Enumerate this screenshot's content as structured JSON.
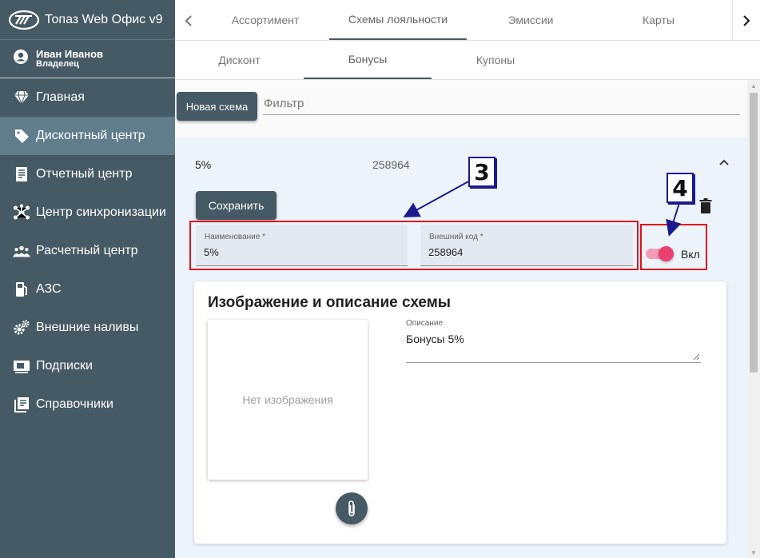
{
  "app": {
    "title": "Топаз Web Офис v9"
  },
  "user": {
    "name": "Иван Иванов",
    "role": "Владелец"
  },
  "sidebar": {
    "items": [
      {
        "label": "Главная",
        "icon": "diamond-icon"
      },
      {
        "label": "Дисконтный центр",
        "icon": "tag-icon",
        "active": true
      },
      {
        "label": "Отчетный центр",
        "icon": "report-icon"
      },
      {
        "label": "Центр синхронизации",
        "icon": "sync-hub-icon"
      },
      {
        "label": "Расчетный центр",
        "icon": "people-group-icon"
      },
      {
        "label": "АЗС",
        "icon": "fuel-pump-icon"
      },
      {
        "label": "Внешние наливы",
        "icon": "gears-icon"
      },
      {
        "label": "Подписки",
        "icon": "subscription-icon"
      },
      {
        "label": "Справочники",
        "icon": "library-icon"
      }
    ]
  },
  "tabs_main": [
    "Ассортимент",
    "Схемы лояльности",
    "Эмиссии",
    "Карты"
  ],
  "tabs_main_active": "Схемы лояльности",
  "tabs_sub": [
    "Дисконт",
    "Бонусы",
    "Купоны"
  ],
  "tabs_sub_active": "Бонусы",
  "toolbar": {
    "new_scheme_label": "Новая схема",
    "filter_placeholder": "Фильтр"
  },
  "scheme": {
    "header_name": "5%",
    "header_code": "258964",
    "save_label": "Сохранить",
    "name_label": "Наименование *",
    "name_value": "5%",
    "code_label": "Внешний код *",
    "code_value": "258964",
    "toggle_label": "Вкл",
    "toggle_on": true
  },
  "image_section": {
    "title": "Изображение и описание схемы",
    "no_image": "Нет изображения",
    "description_label": "Описание",
    "description_value": "Бонусы 5%"
  },
  "callouts": {
    "c3": "3",
    "c4": "4"
  },
  "colors": {
    "sidebar": "#455a64",
    "sidebar_active": "#607d8b",
    "accent_toggle": "#ec3f72",
    "highlight": "#e0141e",
    "callout": "#1b1b8f"
  }
}
